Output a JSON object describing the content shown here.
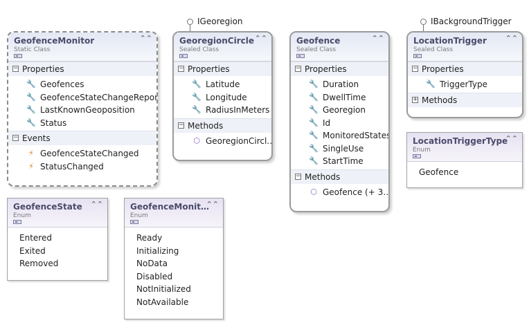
{
  "interfaces": {
    "igeoregion": "IGeoregion",
    "ibackgroundtrigger": "IBackgroundTrigger"
  },
  "geofence_monitor": {
    "name": "GeofenceMonitor",
    "stereotype": "Static Class",
    "properties_label": "Properties",
    "properties": [
      "Geofences",
      "GeofenceStateChangeReports",
      "LastKnownGeoposition",
      "Status"
    ],
    "events_label": "Events",
    "events": [
      "GeofenceStateChanged",
      "StatusChanged"
    ]
  },
  "georegion_circle": {
    "name": "GeoregionCircle",
    "stereotype": "Sealed Class",
    "properties_label": "Properties",
    "properties": [
      "Latitude",
      "Longitude",
      "RadiusInMeters"
    ],
    "methods_label": "Methods",
    "methods": [
      "GeoregionCircl…"
    ]
  },
  "geofence": {
    "name": "Geofence",
    "stereotype": "Sealed Class",
    "properties_label": "Properties",
    "properties": [
      "Duration",
      "DwellTime",
      "Georegion",
      "Id",
      "MonitoredStates",
      "SingleUse",
      "StartTime"
    ],
    "methods_label": "Methods",
    "methods": [
      "Geofence (+ 3…"
    ]
  },
  "location_trigger": {
    "name": "LocationTrigger",
    "stereotype": "Sealed Class",
    "properties_label": "Properties",
    "properties": [
      "TriggerType"
    ],
    "methods_label": "Methods"
  },
  "location_trigger_type": {
    "name": "LocationTriggerType",
    "stereotype": "Enum",
    "values": [
      "Geofence"
    ]
  },
  "geofence_state": {
    "name": "GeofenceState",
    "stereotype": "Enum",
    "values": [
      "Entered",
      "Exited",
      "Removed"
    ]
  },
  "geofence_monitor_status": {
    "name": "GeofenceMonit…",
    "stereotype": "Enum",
    "values": [
      "Ready",
      "Initializing",
      "NoData",
      "Disabled",
      "NotInitialized",
      "NotAvailable"
    ]
  },
  "glyphs": {
    "collapse": "⌃⌃",
    "minus": "−",
    "plus": "+",
    "property_icon": "wrench-icon",
    "event_icon": "lightning-icon",
    "method_icon": "cube-icon"
  }
}
